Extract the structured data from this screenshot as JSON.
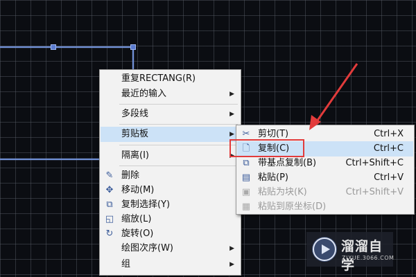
{
  "context_menu": {
    "items": [
      {
        "label": "重复RECTANG(R)"
      },
      {
        "label": "最近的输入"
      },
      {
        "label": "多段线"
      },
      {
        "label": "剪贴板"
      },
      {
        "label": "隔离(I)"
      },
      {
        "label": "删除"
      },
      {
        "label": "移动(M)"
      },
      {
        "label": "复制选择(Y)"
      },
      {
        "label": "缩放(L)"
      },
      {
        "label": "旋转(O)"
      },
      {
        "label": "绘图次序(W)"
      },
      {
        "label": "组"
      }
    ],
    "highlighted": "剪贴板"
  },
  "clipboard_submenu": {
    "items": [
      {
        "label": "剪切(T)",
        "shortcut": "Ctrl+X",
        "icon": "scissors-icon",
        "enabled": true
      },
      {
        "label": "复制(C)",
        "shortcut": "Ctrl+C",
        "icon": "copy-icon",
        "enabled": true
      },
      {
        "label": "带基点复制(B)",
        "shortcut": "Ctrl+Shift+C",
        "icon": "copy-base-point-icon",
        "enabled": true
      },
      {
        "label": "粘贴(P)",
        "shortcut": "Ctrl+V",
        "icon": "paste-icon",
        "enabled": true
      },
      {
        "label": "粘贴为块(K)",
        "shortcut": "Ctrl+Shift+V",
        "icon": "paste-block-icon",
        "enabled": false
      },
      {
        "label": "粘贴到原坐标(D)",
        "shortcut": "",
        "icon": "paste-original-coords-icon",
        "enabled": false
      }
    ],
    "highlighted": "复制(C)"
  },
  "watermark": {
    "title": "溜溜自学",
    "subtitle": "ZIXUE.3066.COM"
  },
  "colors": {
    "canvas_bg": "#0b0d12",
    "selection_line": "#6f8fd6",
    "annotation_red": "#e23b3b",
    "menu_highlight": "#cce2f7"
  }
}
